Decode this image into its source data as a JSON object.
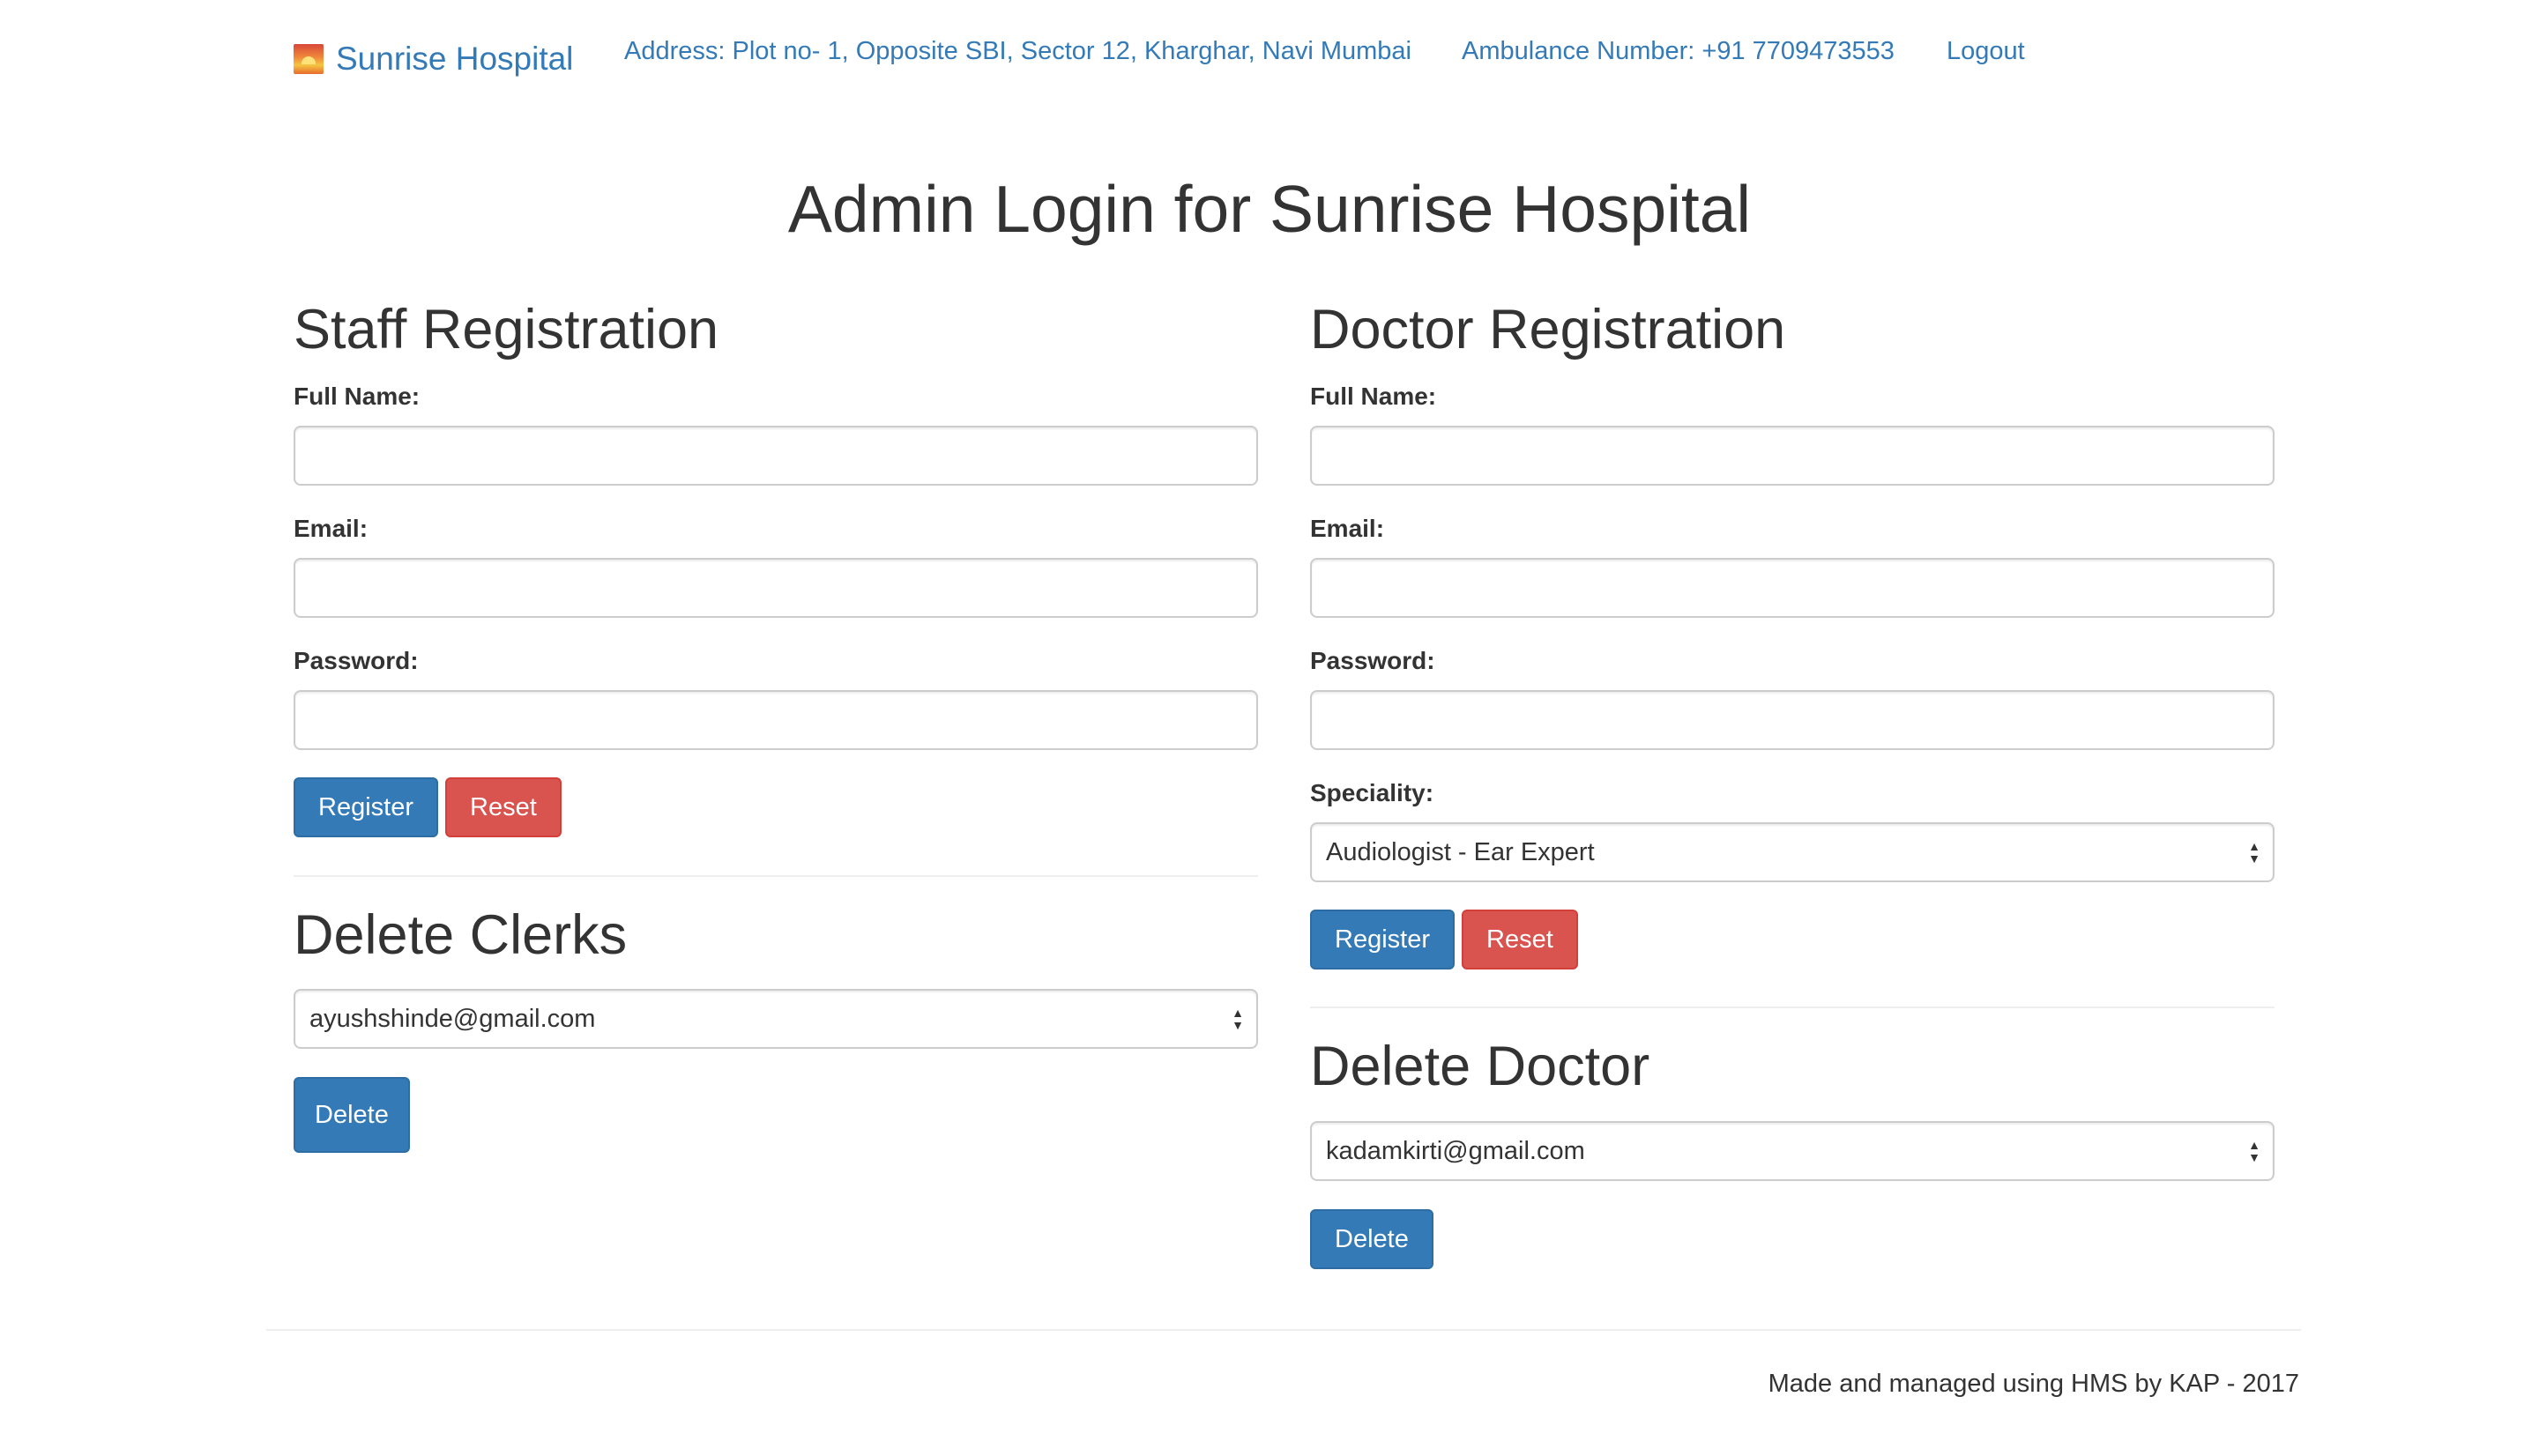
{
  "navbar": {
    "brand": "Sunrise Hospital",
    "brand_icon": "sunrise-icon",
    "address": "Address: Plot no- 1, Opposite SBI, Sector 12, Kharghar, Navi Mumbai",
    "ambulance": "Ambulance Number: +91 7709473553",
    "logout": "Logout"
  },
  "page": {
    "title": "Admin Login for Sunrise Hospital"
  },
  "staff": {
    "heading": "Staff Registration",
    "full_name_label": "Full Name:",
    "full_name_value": "",
    "email_label": "Email:",
    "email_value": "",
    "password_label": "Password:",
    "password_value": "",
    "register": "Register",
    "reset": "Reset"
  },
  "delete_clerks": {
    "heading": "Delete Clerks",
    "selected": "ayushshinde@gmail.com",
    "delete": "Delete"
  },
  "doctor": {
    "heading": "Doctor Registration",
    "full_name_label": "Full Name:",
    "full_name_value": "",
    "email_label": "Email:",
    "email_value": "",
    "password_label": "Password:",
    "password_value": "",
    "speciality_label": "Speciality:",
    "speciality_selected": "Audiologist - Ear Expert",
    "register": "Register",
    "reset": "Reset"
  },
  "delete_doctor": {
    "heading": "Delete Doctor",
    "selected": "kadamkirti@gmail.com",
    "delete": "Delete"
  },
  "footer": {
    "text": "Made and managed using HMS by KAP - 2017"
  },
  "colors": {
    "link": "#337ab7",
    "primary": "#337ab7",
    "danger": "#d9534f"
  }
}
